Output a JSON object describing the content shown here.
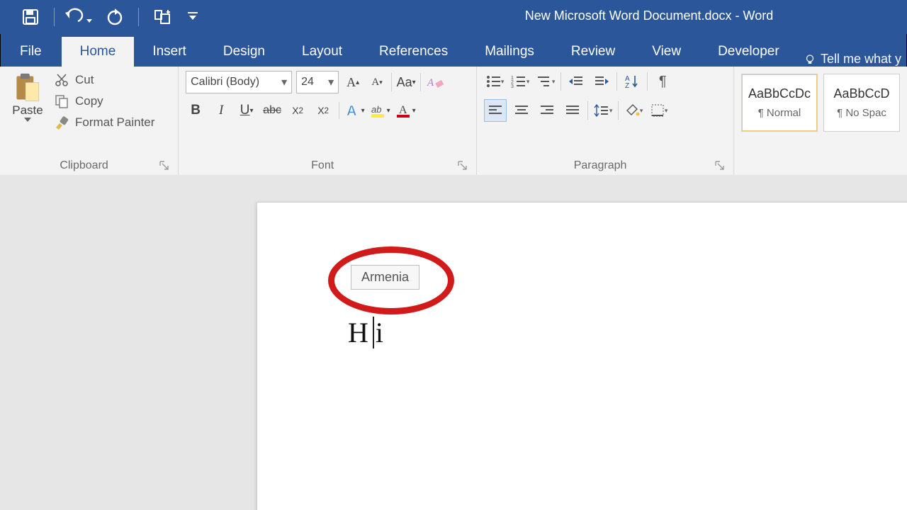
{
  "title": "New Microsoft Word Document.docx - Word",
  "tabs": {
    "file": "File",
    "home": "Home",
    "insert": "Insert",
    "design": "Design",
    "layout": "Layout",
    "references": "References",
    "mailings": "Mailings",
    "review": "Review",
    "view": "View",
    "developer": "Developer",
    "tellme": "Tell me what y"
  },
  "clipboard": {
    "paste": "Paste",
    "cut": "Cut",
    "copy": "Copy",
    "format_painter": "Format Painter",
    "group": "Clipboard"
  },
  "font": {
    "name": "Calibri (Body)",
    "size": "24",
    "group": "Font"
  },
  "paragraph": {
    "group": "Paragraph"
  },
  "styles": {
    "sample": "AaBbCcDc",
    "normal": "¶ Normal",
    "sample2": "AaBbCcD",
    "nospac": "¶ No Spac"
  },
  "document": {
    "text": "Hi",
    "tooltip": "Armenia"
  }
}
